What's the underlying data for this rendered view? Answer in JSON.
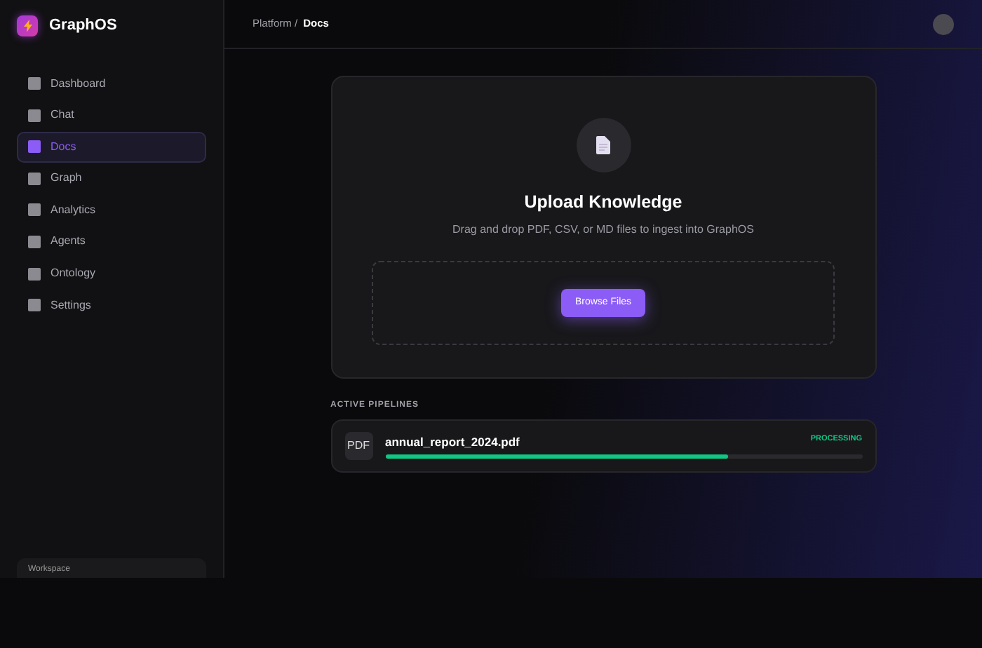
{
  "brand": {
    "name": "GraphOS"
  },
  "sidebar": {
    "items": [
      {
        "label": "Dashboard",
        "selected": false
      },
      {
        "label": "Chat",
        "selected": false
      },
      {
        "label": "Docs",
        "selected": true
      },
      {
        "label": "Graph",
        "selected": false
      },
      {
        "label": "Analytics",
        "selected": false
      },
      {
        "label": "Agents",
        "selected": false
      },
      {
        "label": "Ontology",
        "selected": false
      },
      {
        "label": "Settings",
        "selected": false
      }
    ],
    "footer": {
      "label": "Workspace"
    }
  },
  "breadcrumb": {
    "parent": "Platform /",
    "current": "Docs"
  },
  "upload": {
    "title": "Upload Knowledge",
    "subtitle": "Drag and drop PDF, CSV, or MD files to ingest into GraphOS",
    "button": "Browse Files"
  },
  "pipelines": {
    "heading": "ACTIVE PIPELINES",
    "items": [
      {
        "type_label": "PDF",
        "file": "annual_report_2024.pdf",
        "status": "PROCESSING",
        "level": 0.72
      }
    ]
  }
}
